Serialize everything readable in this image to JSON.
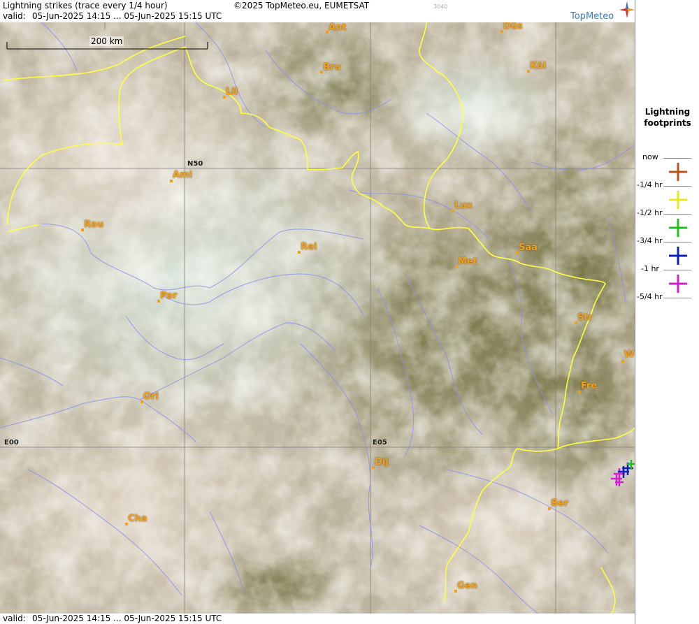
{
  "header": {
    "title": "Lightning strikes (trace every 1/4 hour)",
    "copyright": "©2025 TopMeteo.eu, EUMETSAT",
    "code": "3040",
    "valid_label": "valid:",
    "valid_range": "05-Jun-2025 14:15 ... 05-Jun-2025 15:15 UTC",
    "logo": "TopMeteo",
    "logo_icon": "compass-star-icon"
  },
  "footer": {
    "valid_label": "valid:",
    "valid_range": "05-Jun-2025 14:15 ... 05-Jun-2025 15:15 UTC"
  },
  "scale": {
    "label": "200 km"
  },
  "grid": {
    "lat_label": "N50",
    "lon_label_1": "E00",
    "lon_label_2": "E05"
  },
  "cities": [
    "Ant",
    "Düs",
    "Bru",
    "Köl",
    "Lil",
    "Ami",
    "Lux",
    "Rou",
    "Rei",
    "Saa",
    "Met",
    "Par",
    "Str",
    "W",
    "Fre",
    "Orl",
    "Dij",
    "Ber",
    "Cha",
    "Gen"
  ],
  "legend": {
    "title_line1": "Lightning",
    "title_line2": "footprints",
    "items": [
      {
        "label": "now",
        "color": ""
      },
      {
        "label": "-1/4 hr",
        "color": "#c0501a"
      },
      {
        "label": "-1/2 hr",
        "color": "#e8e820"
      },
      {
        "label": "-3/4 hr",
        "color": "#20c020"
      },
      {
        "label": "-1 hr",
        "color": "#1020c0"
      },
      {
        "label": "-5/4 hr",
        "color": "#d020d0"
      }
    ]
  },
  "colors": {
    "border": "#ffff40",
    "river": "#8a90ee",
    "city": "#f0a020",
    "grid": "#808080"
  }
}
